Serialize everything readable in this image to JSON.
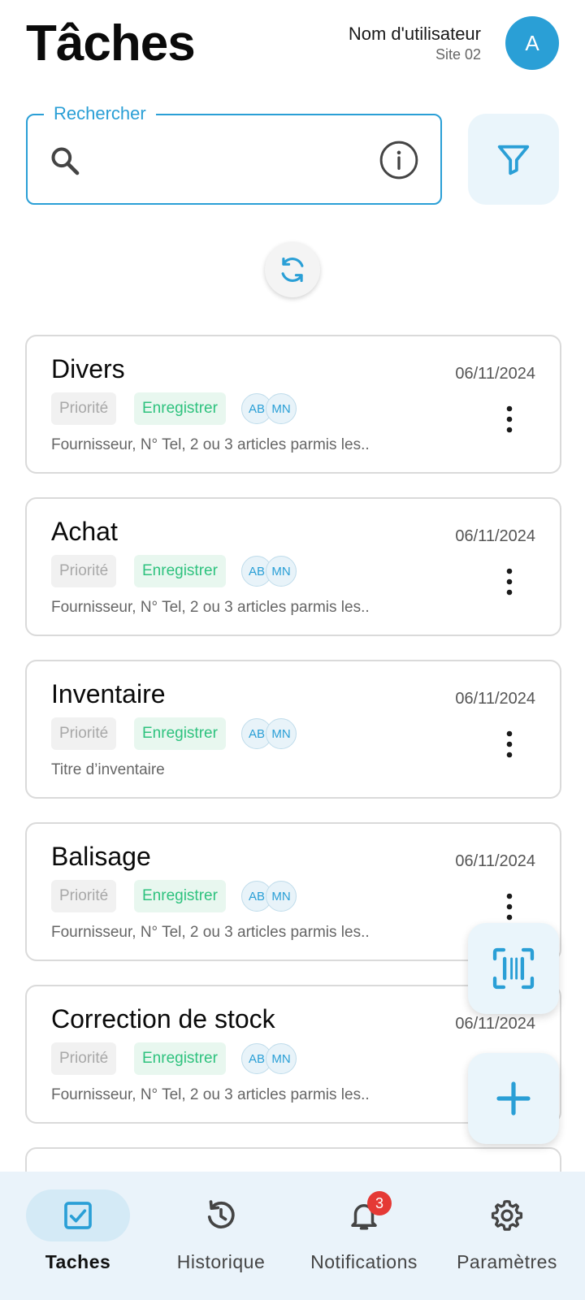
{
  "header": {
    "title": "Tâches",
    "user_name": "Nom d'utilisateur",
    "site": "Site 02",
    "avatar_initial": "A"
  },
  "search": {
    "label": "Rechercher",
    "value": "",
    "placeholder": ""
  },
  "tasks": [
    {
      "title": "Divers",
      "date": "06/11/2024",
      "priority_label": "Priorité",
      "status_label": "Enregistrer",
      "assignees": [
        "AB",
        "MN"
      ],
      "description": "Fournisseur, N° Tel, 2 ou 3 articles parmis les.."
    },
    {
      "title": "Achat",
      "date": "06/11/2024",
      "priority_label": "Priorité",
      "status_label": "Enregistrer",
      "assignees": [
        "AB",
        "MN"
      ],
      "description": "Fournisseur, N° Tel, 2 ou 3 articles parmis les.."
    },
    {
      "title": "Inventaire",
      "date": "06/11/2024",
      "priority_label": "Priorité",
      "status_label": "Enregistrer",
      "assignees": [
        "AB",
        "MN"
      ],
      "description": "Titre d’inventaire"
    },
    {
      "title": "Balisage",
      "date": "06/11/2024",
      "priority_label": "Priorité",
      "status_label": "Enregistrer",
      "assignees": [
        "AB",
        "MN"
      ],
      "description": "Fournisseur, N° Tel, 2 ou 3 articles parmis les.."
    },
    {
      "title": "Correction de stock",
      "date": "06/11/2024",
      "priority_label": "Priorité",
      "status_label": "Enregistrer",
      "assignees": [
        "AB",
        "MN"
      ],
      "description": "Fournisseur, N° Tel, 2 ou 3 articles parmis les.."
    }
  ],
  "bottom_nav": {
    "items": [
      {
        "label": "Taches",
        "icon": "checkbox-icon",
        "active": true
      },
      {
        "label": "Historique",
        "icon": "history-icon",
        "active": false
      },
      {
        "label": "Notifications",
        "icon": "bell-icon",
        "active": false,
        "badge": "3"
      },
      {
        "label": "Paramètres",
        "icon": "gear-icon",
        "active": false
      }
    ]
  },
  "colors": {
    "accent": "#2a9fd6",
    "status_green": "#2ec27e",
    "badge_red": "#e53935",
    "nav_background": "#eaf3fa"
  }
}
